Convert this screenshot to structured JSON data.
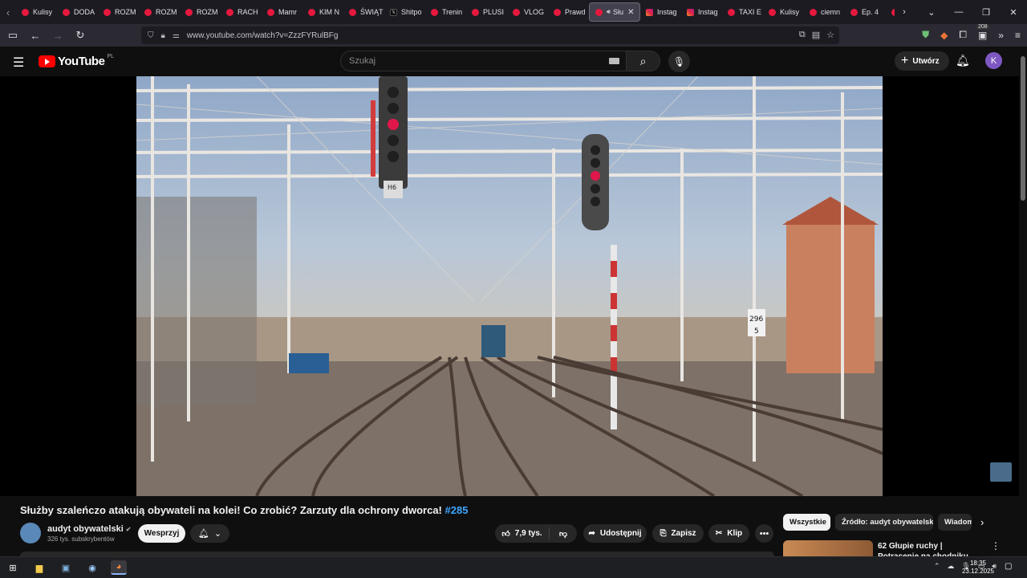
{
  "browser": {
    "tabs": [
      {
        "label": "Kulisy",
        "icon": "yt"
      },
      {
        "label": "DODA",
        "icon": "yt"
      },
      {
        "label": "ROZM",
        "icon": "yt"
      },
      {
        "label": "ROZM",
        "icon": "yt"
      },
      {
        "label": "ROZM",
        "icon": "yt"
      },
      {
        "label": "RACH",
        "icon": "yt"
      },
      {
        "label": "Mamr",
        "icon": "yt"
      },
      {
        "label": "KIM N",
        "icon": "yt"
      },
      {
        "label": "ŚWIĄT",
        "icon": "yt"
      },
      {
        "label": "Shitpo",
        "icon": "x"
      },
      {
        "label": "Trenin",
        "icon": "yt"
      },
      {
        "label": "PLUSI",
        "icon": "yt"
      },
      {
        "label": "VLOG",
        "icon": "yt"
      },
      {
        "label": "Prawd",
        "icon": "yt"
      },
      {
        "label": "Słu",
        "icon": "yt",
        "active": true
      },
      {
        "label": "Instag",
        "icon": "ig"
      },
      {
        "label": "Instag",
        "icon": "ig"
      },
      {
        "label": "TAXI E",
        "icon": "yt"
      },
      {
        "label": "Kulisy",
        "icon": "yt"
      },
      {
        "label": "ciemn",
        "icon": "yt"
      },
      {
        "label": "Ep. 4",
        "icon": "yt"
      },
      {
        "label": "",
        "icon": "yt"
      }
    ],
    "url": "www.youtube.com/watch?v=ZzzFYRulBFg",
    "extension_badge": "208"
  },
  "header": {
    "logo": "YouTube",
    "region": "PL",
    "search_placeholder": "Szukaj",
    "create_label": "Utwórz",
    "avatar_letter": "K"
  },
  "video": {
    "title": "Służby szaleńczo atakują obywateli na kolei! Co zrobić? Zarzuty dla ochrony dworca!",
    "hashtag": "#285",
    "channel": "audyt obywatelski",
    "subscribers": "326 tys. subskrybentów",
    "support_label": "Wesprzyj",
    "likes": "7,9 tys.",
    "share_label": "Udostępnij",
    "save_label": "Zapisz",
    "clip_label": "Klip",
    "scene_labels": {
      "signal_left": "H6",
      "km_post_1": "296",
      "km_post_2": "5"
    }
  },
  "sidebar": {
    "chips": [
      "Wszystkie",
      "Źródło: audyt obywatelski",
      "Wiadomości"
    ],
    "recommendation_title": "62 Głupie ruchy | Potrącenie na chodniku"
  },
  "taskbar": {
    "time": "18:35",
    "date": "23.12.2025"
  }
}
